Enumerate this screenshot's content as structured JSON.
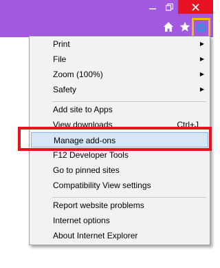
{
  "browser": {
    "colors": {
      "titlebar": "#a358e0",
      "close": "#e81123",
      "gear_highlight": "#f5b800",
      "callout": "#e8121f",
      "menu_highlight": "#d6e6f5"
    },
    "window_controls": {
      "minimize_icon": "minimize-icon",
      "restore_icon": "restore-icon",
      "close_icon": "close-icon"
    },
    "toolbar_icons": [
      "home-icon",
      "star-icon",
      "gear-icon"
    ]
  },
  "tools_menu": {
    "items": [
      {
        "label": "Print",
        "submenu": true
      },
      {
        "label": "File",
        "submenu": true
      },
      {
        "label": "Zoom (100%)",
        "submenu": true
      },
      {
        "label": "Safety",
        "submenu": true
      },
      {
        "label": "Add site to Apps"
      },
      {
        "label": "View downloads",
        "shortcut": "Ctrl+J"
      },
      {
        "label": "Manage add-ons",
        "highlighted": true
      },
      {
        "label": "F12 Developer Tools"
      },
      {
        "label": "Go to pinned sites"
      },
      {
        "label": "Compatibility View settings"
      },
      {
        "label": "Report website problems"
      },
      {
        "label": "Internet options"
      },
      {
        "label": "About Internet Explorer"
      }
    ],
    "arrow_glyph": "▶"
  }
}
